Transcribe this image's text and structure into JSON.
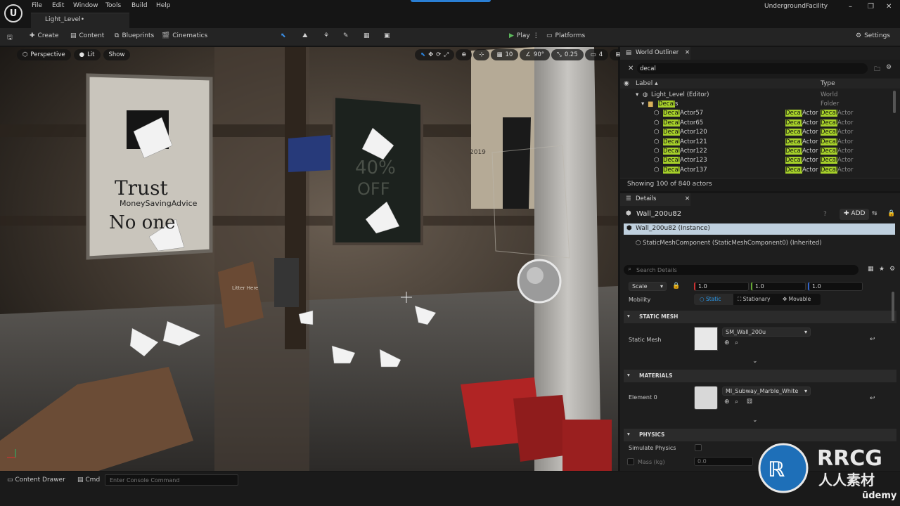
{
  "menu": {
    "items": [
      "File",
      "Edit",
      "Window",
      "Tools",
      "Build",
      "Help"
    ]
  },
  "level_tab": "Light_Level•",
  "window_title": "UndergroundFacility",
  "toolbar": {
    "create": "Create",
    "content": "Content",
    "blueprints": "Blueprints",
    "cinematics": "Cinematics",
    "play": "Play",
    "platforms": "Platforms",
    "settings": "Settings"
  },
  "viewport": {
    "perspective": "Perspective",
    "lit": "Lit",
    "show": "Show",
    "grid_snap": "10",
    "rot_snap": "90°",
    "scale_snap": "0.25",
    "cam_speed": "4",
    "poster_text": [
      "Trust",
      "MoneySavingAdvice",
      "No one",
      "40%",
      "OFF",
      "Litter Here",
      "2019"
    ]
  },
  "outliner": {
    "tab": "World Outliner",
    "search_value": "decal",
    "col_label": "Label",
    "col_type": "Type",
    "root": {
      "label": "Light_Level (Editor)",
      "type": "World"
    },
    "folder": {
      "label_hl": "Decal",
      "label_rest": "s",
      "type": "Folder"
    },
    "actors": [
      {
        "hl": "Decal",
        "name": "Actor57",
        "t1": "Decal",
        "t2": "Actor"
      },
      {
        "hl": "Decal",
        "name": "Actor65",
        "t1": "Decal",
        "t2": "Actor"
      },
      {
        "hl": "Decal",
        "name": "Actor120",
        "t1": "Decal",
        "t2": "Actor"
      },
      {
        "hl": "Decal",
        "name": "Actor121",
        "t1": "Decal",
        "t2": "Actor"
      },
      {
        "hl": "Decal",
        "name": "Actor122",
        "t1": "Decal",
        "t2": "Actor"
      },
      {
        "hl": "Decal",
        "name": "Actor123",
        "t1": "Decal",
        "t2": "Actor"
      },
      {
        "hl": "Decal",
        "name": "Actor137",
        "t1": "Decal",
        "t2": "Actor"
      }
    ],
    "footer": "Showing 100 of 840 actors"
  },
  "details": {
    "tab": "Details",
    "object_name": "Wall_200u82",
    "add_label": "ADD",
    "instance": "Wall_200u82 (Instance)",
    "component": "StaticMeshComponent (StaticMeshComponent0) (Inherited)",
    "search_placeholder": "Search Details",
    "scale_label": "Scale",
    "scale": [
      "1.0",
      "1.0",
      "1.0"
    ],
    "mobility_label": "Mobility",
    "mobility": [
      "Static",
      "Stationary",
      "Movable"
    ],
    "sec_static_mesh": "STATIC MESH",
    "static_mesh_label": "Static Mesh",
    "static_mesh_value": "SM_Wall_200u",
    "sec_materials": "MATERIALS",
    "element_label": "Element 0",
    "material_value": "MI_Subway_Marble_White",
    "sec_physics": "PHYSICS",
    "simulate_label": "Simulate Physics",
    "mass_label": "Mass (kg)",
    "mass_value": "0.0"
  },
  "status": {
    "content_drawer": "Content Drawer",
    "cmd": "Cmd",
    "console_placeholder": "Enter Console Command"
  },
  "watermark": {
    "brand": "RRCG",
    "sub": "人人素材"
  },
  "udemy": "ūdemy",
  "colors": {
    "accent_blue": "#2a7fd4",
    "search_hl": "#a6d02a",
    "play_green": "#5cb85c"
  }
}
